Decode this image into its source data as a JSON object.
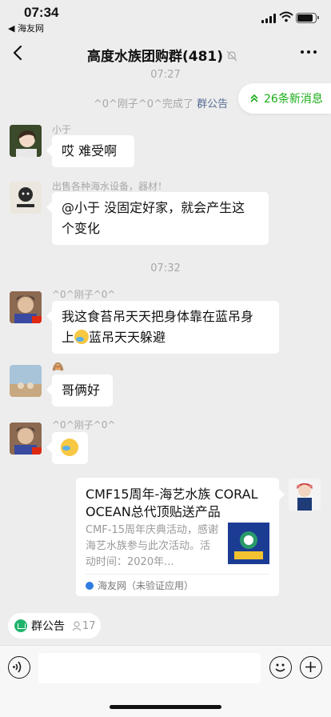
{
  "status_bar": {
    "time": "07:34",
    "back_app": "◀ 海友网"
  },
  "header": {
    "title": "高度水族团购群(481)"
  },
  "new_messages": {
    "label": "26条新消息"
  },
  "messages": {
    "ts1": "07:27",
    "sys_prefix": "^0^刚子^0^完成了",
    "sys_link": "群公告",
    "m1_name": "小于",
    "m1_text": "哎  难受啊",
    "m2_name": "出售各种海水设备，器材！",
    "m2_line1": "@小于 没固定好家，就会产生这",
    "m2_line2": "个变化",
    "ts2": "07:32",
    "m3_name": "^0^刚子^0^",
    "m3_line1": "我这食苔吊天天把身体靠在蓝吊身",
    "m3_line2_pre": "上",
    "m3_line2_post": "蓝吊天天躲避",
    "m4_name": "🙈",
    "m4_text": "哥俩好",
    "m5_name": "^0^刚子^0^"
  },
  "card": {
    "title": "CMF15周年-海艺水族 CORAL OCEAN总代顶贴送产品",
    "desc": "CMF-15周年庆典活动，感谢海艺水族参与此次活动。活动时间：2020年...",
    "source": "海友网（未验证应用）"
  },
  "notice_bar": {
    "label": "群公告",
    "count": "17"
  },
  "colors": {
    "background": "#ededed",
    "bubble": "#ffffff",
    "link": "#576b95",
    "accent_green": "#1aad19",
    "timestamp": "#a8a8a8"
  },
  "icons": [
    "back-chevron-icon",
    "mute-bell-icon",
    "more-dots-icon",
    "double-chevron-up-icon",
    "voice-icon",
    "emoji-face-icon",
    "plus-icon",
    "people-icon"
  ]
}
